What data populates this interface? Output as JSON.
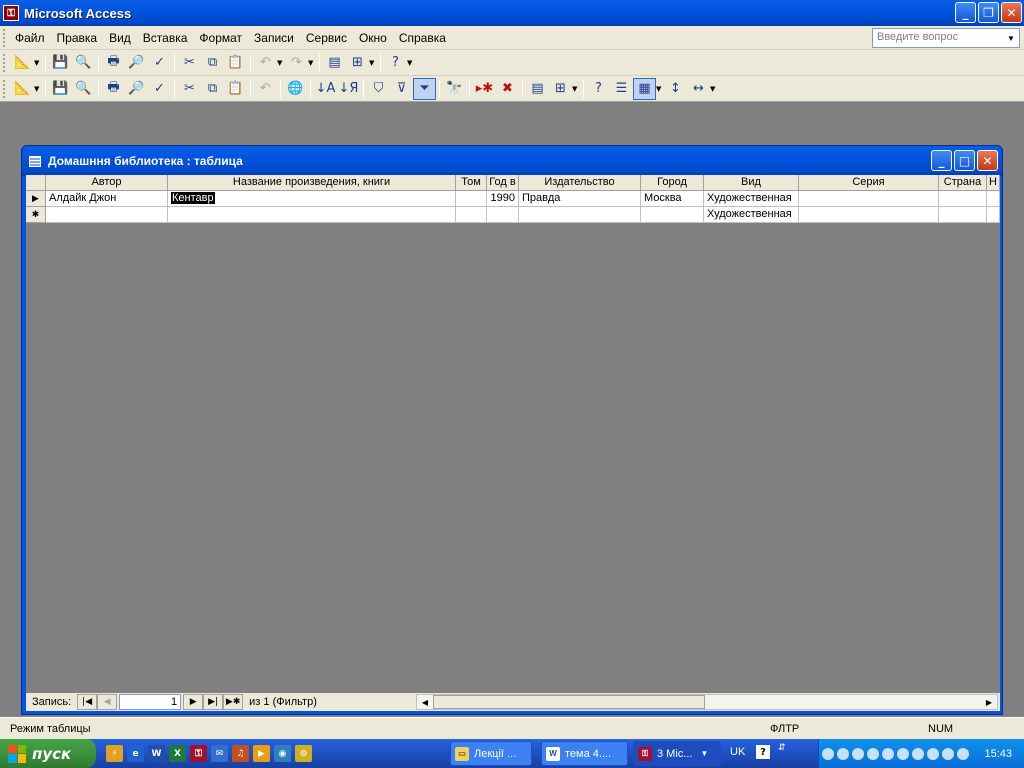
{
  "app": {
    "title": "Microsoft Access"
  },
  "menu": {
    "items": [
      "Файл",
      "Правка",
      "Вид",
      "Вставка",
      "Формат",
      "Записи",
      "Сервис",
      "Окно",
      "Справка"
    ]
  },
  "help": {
    "placeholder": "Введите вопрос"
  },
  "child_window": {
    "title": "Домашння библиотека : таблица"
  },
  "table": {
    "columns": [
      "Автор",
      "Название произведения, книги",
      "Том",
      "Год в",
      "Издательство",
      "Город",
      "Вид",
      "Серия",
      "Страна",
      "Н"
    ],
    "rows": [
      {
        "selector": "▶",
        "cells": [
          "Алдайк Джон",
          "Кентавр",
          "",
          "1990",
          "Правда",
          "Москва",
          "Художественная",
          "",
          "",
          ""
        ]
      },
      {
        "selector": "✱",
        "cells": [
          "",
          "",
          "",
          "",
          "",
          "",
          "Художественная",
          "",
          "",
          ""
        ]
      }
    ]
  },
  "navigation": {
    "label": "Запись:",
    "current_record": "1",
    "of_text": "из  1 (Фильтр)"
  },
  "status": {
    "mode": "Режим таблицы",
    "filter": "ФЛТР",
    "num": "NUM"
  },
  "taskbar": {
    "start_label": "пуск",
    "tasks": [
      "Лекції ...",
      "тема 4....",
      "3 Mic..."
    ],
    "language": "UK",
    "clock": "15:43"
  },
  "icons": {
    "toolbar1": [
      "view-design-icon",
      "save-icon",
      "search-file-icon",
      "print-icon",
      "print-preview-icon",
      "spellcheck-icon",
      "cut-icon",
      "copy-icon",
      "paste-icon",
      "undo-icon",
      "redo-icon",
      "office-links-icon",
      "analyze-icon",
      "help-icon"
    ],
    "toolbar2": [
      "view-design-icon",
      "save-icon",
      "search-file-icon",
      "print-icon",
      "print-preview-icon",
      "spellcheck-icon",
      "cut-icon",
      "copy-icon",
      "paste-icon",
      "undo-icon",
      "insert-hyperlink-icon",
      "sort-ascending-icon",
      "sort-descending-icon",
      "filter-by-selection-icon",
      "filter-by-form-icon",
      "apply-filter-icon",
      "find-icon",
      "new-record-icon",
      "delete-record-icon",
      "database-window-icon",
      "new-object-icon",
      "help-icon",
      "properties-icon",
      "datasheet-view-icon",
      "row-height-icon",
      "column-width-icon"
    ]
  }
}
